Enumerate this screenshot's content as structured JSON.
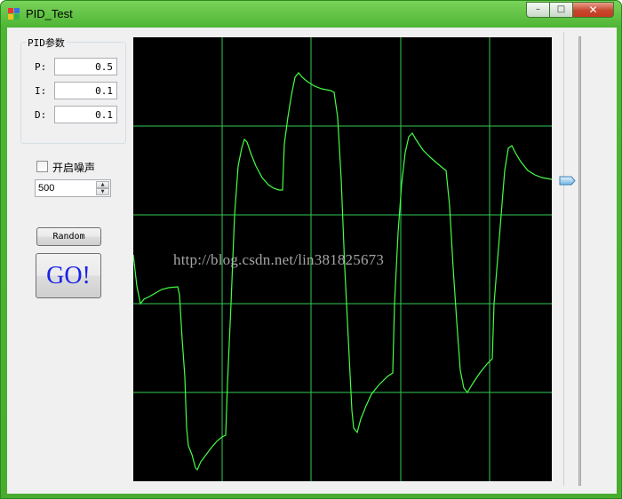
{
  "window": {
    "title": "PID_Test",
    "controls": {
      "minimize": "–",
      "maximize": "□",
      "close": "✕"
    }
  },
  "pid": {
    "group_title": "PID参数",
    "params": [
      {
        "label": "P:",
        "value": "0.5"
      },
      {
        "label": "I:",
        "value": "0.1"
      },
      {
        "label": "D:",
        "value": "0.1"
      }
    ]
  },
  "noise": {
    "label": "开启噪声",
    "checked": false,
    "value": "500"
  },
  "buttons": {
    "random": "Random",
    "go": "GO!"
  },
  "plot": {
    "watermark": "http://blog.csdn.net/lin381825673",
    "background": "#000000",
    "grid_color": "#33cc55",
    "line_color": "#44ff44",
    "gridlines_vertical": 4,
    "gridlines_horizontal": 4
  },
  "slider": {
    "value_fraction": 0.33,
    "orientation": "vertical"
  },
  "icons": [
    "app-icon",
    "minimize-icon",
    "maximize-icon",
    "close-icon",
    "spin-up-icon",
    "spin-down-icon",
    "slider-thumb-icon"
  ],
  "colors": {
    "title_bar": "#4fb534",
    "go_text": "#1a23e6",
    "client_bg": "#f0f0f0"
  }
}
